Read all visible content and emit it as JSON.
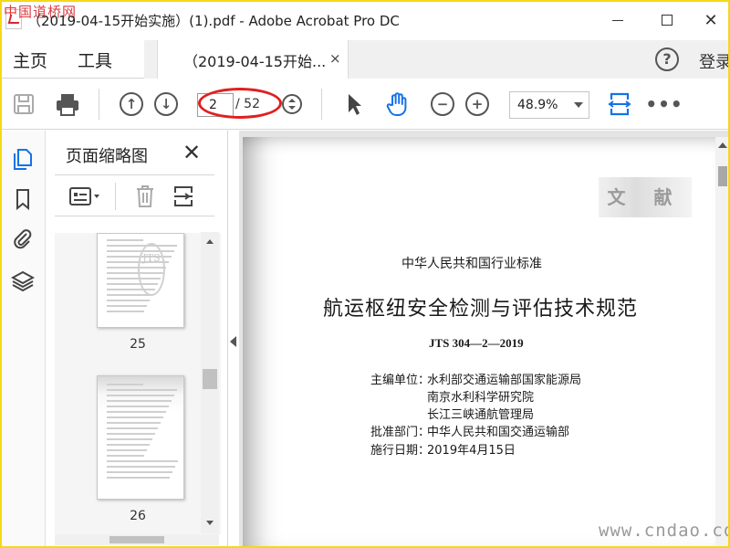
{
  "watermark_top": "中国道桥网",
  "window": {
    "title": "（2019-04-15开始实施）(1).pdf - Adobe Acrobat Pro DC",
    "minimize_icon": "minimize-icon",
    "maximize_icon": "maximize-icon",
    "close_label": "✕"
  },
  "nav": {
    "home": "主页",
    "tools": "工具",
    "doc_tab": "（2019-04-15开始...",
    "doc_tab_close": "×",
    "help": "?",
    "signin": "登录"
  },
  "toolbar": {
    "current_page": "2",
    "total_pages": "/ 52",
    "zoom": "48.9%",
    "more": "•••",
    "icons": [
      "save-icon",
      "print-icon",
      "page-up-icon",
      "page-down-icon",
      "page-stepper-icon",
      "select-arrow-icon",
      "hand-tool-icon",
      "zoom-out-icon",
      "zoom-in-icon",
      "fit-width-icon",
      "more-icon"
    ]
  },
  "rail": {
    "icons": [
      "page-thumbnails-icon",
      "bookmarks-icon",
      "attachments-icon",
      "layers-icon"
    ]
  },
  "thumbnail_panel": {
    "title": "页面缩略图",
    "close": "✕",
    "thumbs": [
      {
        "label": "25"
      },
      {
        "label": "26"
      }
    ],
    "thumb_stamp": "JTS"
  },
  "document": {
    "stamp": "文 献",
    "header": "中华人民共和国行业标准",
    "title": "航运枢纽安全检测与评估技术规范",
    "code": "JTS 304—2—2019",
    "rows": [
      {
        "label": "主编单位：",
        "value": "水利部交通运输部国家能源局"
      },
      {
        "label": "",
        "value": "南京水利科学研究院"
      },
      {
        "label": "",
        "value": "长江三峡通航管理局"
      },
      {
        "label": "批准部门：",
        "value": "中华人民共和国交通运输部"
      },
      {
        "label": "施行日期：",
        "value": "2019年4月15日"
      }
    ]
  },
  "watermark_bottom": "www.cndao.com",
  "colors": {
    "frame": "#f5d816",
    "accent_blue": "#1473e6",
    "annotation_red": "#e02020"
  }
}
